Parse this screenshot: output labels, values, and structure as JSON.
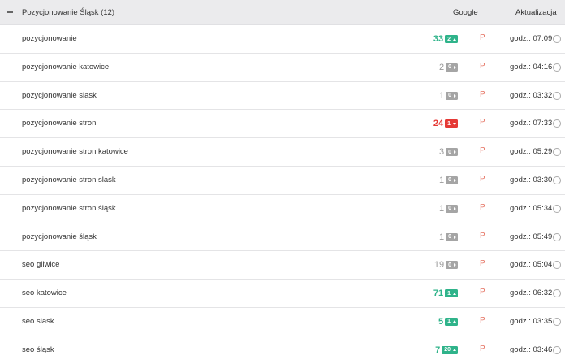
{
  "header": {
    "group_title": "Pozycjonowanie Śląsk (12)",
    "col_google": "Google",
    "col_aktualizacja": "Aktualizacja"
  },
  "rows": [
    {
      "keyword": "pozycjonowanie",
      "position": "33",
      "pos_color": "green",
      "change": "2",
      "change_color": "green",
      "arrow": "up",
      "p": "P",
      "time": "godz.: 07:09"
    },
    {
      "keyword": "pozycjonowanie katowice",
      "position": "2",
      "pos_color": "gray",
      "change": "0",
      "change_color": "gray",
      "arrow": "right",
      "p": "P",
      "time": "godz.: 04:16"
    },
    {
      "keyword": "pozycjonowanie slask",
      "position": "1",
      "pos_color": "gray",
      "change": "0",
      "change_color": "gray",
      "arrow": "right",
      "p": "P",
      "time": "godz.: 03:32"
    },
    {
      "keyword": "pozycjonowanie stron",
      "position": "24",
      "pos_color": "red",
      "change": "1",
      "change_color": "red",
      "arrow": "down",
      "p": "P",
      "time": "godz.: 07:33"
    },
    {
      "keyword": "pozycjonowanie stron katowice",
      "position": "3",
      "pos_color": "gray",
      "change": "0",
      "change_color": "gray",
      "arrow": "right",
      "p": "P",
      "time": "godz.: 05:29"
    },
    {
      "keyword": "pozycjonowanie stron slask",
      "position": "1",
      "pos_color": "gray",
      "change": "0",
      "change_color": "gray",
      "arrow": "right",
      "p": "P",
      "time": "godz.: 03:30"
    },
    {
      "keyword": "pozycjonowanie stron śląsk",
      "position": "1",
      "pos_color": "gray",
      "change": "0",
      "change_color": "gray",
      "arrow": "right",
      "p": "P",
      "time": "godz.: 05:34"
    },
    {
      "keyword": "pozycjonowanie śląsk",
      "position": "1",
      "pos_color": "gray",
      "change": "0",
      "change_color": "gray",
      "arrow": "right",
      "p": "P",
      "time": "godz.: 05:49"
    },
    {
      "keyword": "seo gliwice",
      "position": "19",
      "pos_color": "gray",
      "change": "0",
      "change_color": "gray",
      "arrow": "right",
      "p": "P",
      "time": "godz.: 05:04"
    },
    {
      "keyword": "seo katowice",
      "position": "71",
      "pos_color": "green",
      "change": "1",
      "change_color": "green",
      "arrow": "up",
      "p": "P",
      "time": "godz.: 06:32"
    },
    {
      "keyword": "seo slask",
      "position": "5",
      "pos_color": "green",
      "change": "1",
      "change_color": "green",
      "arrow": "up",
      "p": "P",
      "time": "godz.: 03:35"
    },
    {
      "keyword": "seo śląsk",
      "position": "7",
      "pos_color": "green",
      "change": "20",
      "change_color": "green",
      "arrow": "up",
      "p": "P",
      "time": "godz.: 03:46"
    }
  ],
  "icons": {
    "collapse": "minus-icon",
    "arrow_up": "arrow-up-icon",
    "arrow_down": "arrow-down-icon",
    "arrow_right": "arrow-right-icon",
    "clock": "clock-icon"
  },
  "colors": {
    "green": "#2fb38a",
    "red": "#e53935",
    "gray": "#a5a5a5",
    "p_link": "#e57363",
    "header_bg": "#ebebed"
  }
}
